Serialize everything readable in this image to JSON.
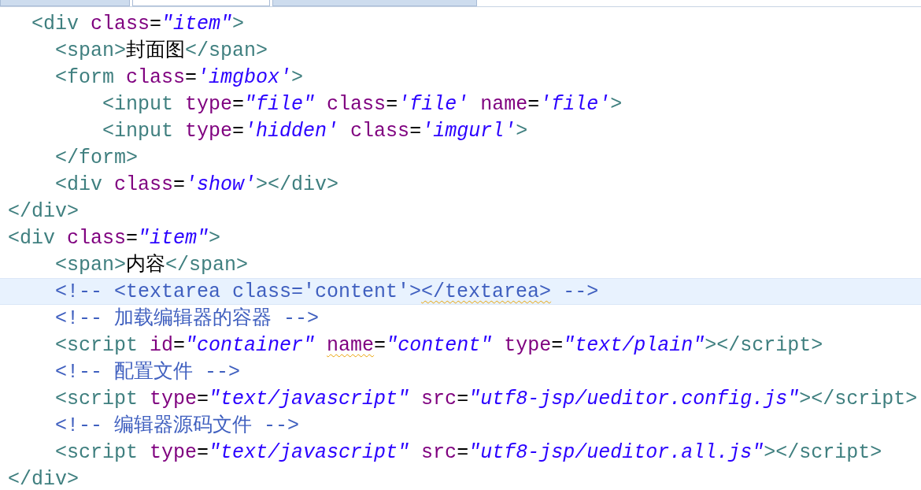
{
  "tabs": [
    {
      "selected": false
    },
    {
      "selected": true
    },
    {
      "selected": false
    }
  ],
  "lines": [
    {
      "current": false,
      "tokens": [
        {
          "kind": "tag",
          "text": "  <div "
        },
        {
          "kind": "attr",
          "text": "class"
        },
        {
          "kind": "plain",
          "text": "="
        },
        {
          "kind": "value",
          "text": "\"item\""
        },
        {
          "kind": "tag",
          "text": ">"
        }
      ]
    },
    {
      "current": false,
      "tokens": [
        {
          "kind": "tag",
          "text": "    <span>"
        },
        {
          "kind": "plain",
          "text": "封面图"
        },
        {
          "kind": "tag",
          "text": "</span>"
        }
      ]
    },
    {
      "current": false,
      "tokens": [
        {
          "kind": "tag",
          "text": "    <form "
        },
        {
          "kind": "attr",
          "text": "class"
        },
        {
          "kind": "plain",
          "text": "="
        },
        {
          "kind": "value",
          "text": "'imgbox'"
        },
        {
          "kind": "tag",
          "text": ">"
        }
      ]
    },
    {
      "current": false,
      "tokens": [
        {
          "kind": "tag",
          "text": "        <input "
        },
        {
          "kind": "attr",
          "text": "type"
        },
        {
          "kind": "plain",
          "text": "="
        },
        {
          "kind": "value",
          "text": "\"file\" "
        },
        {
          "kind": "attr",
          "text": "class"
        },
        {
          "kind": "plain",
          "text": "="
        },
        {
          "kind": "value",
          "text": "'file' "
        },
        {
          "kind": "attr",
          "text": "name"
        },
        {
          "kind": "plain",
          "text": "="
        },
        {
          "kind": "value",
          "text": "'file'"
        },
        {
          "kind": "tag",
          "text": ">"
        }
      ]
    },
    {
      "current": false,
      "tokens": [
        {
          "kind": "tag",
          "text": "        <input "
        },
        {
          "kind": "attr",
          "text": "type"
        },
        {
          "kind": "plain",
          "text": "="
        },
        {
          "kind": "value",
          "text": "'hidden' "
        },
        {
          "kind": "attr",
          "text": "class"
        },
        {
          "kind": "plain",
          "text": "="
        },
        {
          "kind": "value",
          "text": "'imgurl'"
        },
        {
          "kind": "tag",
          "text": ">"
        }
      ]
    },
    {
      "current": false,
      "tokens": [
        {
          "kind": "tag",
          "text": "    </form>"
        }
      ]
    },
    {
      "current": false,
      "tokens": [
        {
          "kind": "tag",
          "text": "    <div "
        },
        {
          "kind": "attr",
          "text": "class"
        },
        {
          "kind": "plain",
          "text": "="
        },
        {
          "kind": "value",
          "text": "'show'"
        },
        {
          "kind": "tag",
          "text": "></div>"
        }
      ]
    },
    {
      "current": false,
      "tokens": [
        {
          "kind": "tag",
          "text": "</div>"
        }
      ]
    },
    {
      "current": false,
      "tokens": [
        {
          "kind": "tag",
          "text": "<div "
        },
        {
          "kind": "attr",
          "text": "class"
        },
        {
          "kind": "plain",
          "text": "="
        },
        {
          "kind": "value",
          "text": "\"item\""
        },
        {
          "kind": "tag",
          "text": ">"
        }
      ]
    },
    {
      "current": false,
      "tokens": [
        {
          "kind": "tag",
          "text": "    <span>"
        },
        {
          "kind": "plain",
          "text": "内容"
        },
        {
          "kind": "tag",
          "text": "</span>"
        }
      ]
    },
    {
      "current": true,
      "tokens": [
        {
          "kind": "comment",
          "text": "    <!-- <textarea class='content'>",
          "warning": false
        },
        {
          "kind": "comment",
          "text": "</textarea>",
          "warning": true
        },
        {
          "kind": "comment",
          "text": " -->",
          "warning": false
        }
      ]
    },
    {
      "current": false,
      "tokens": [
        {
          "kind": "comment",
          "text": "    <!-- 加载编辑器的容器 -->"
        }
      ]
    },
    {
      "current": false,
      "tokens": [
        {
          "kind": "tag",
          "text": "    <script "
        },
        {
          "kind": "attr",
          "text": "id",
          "warning": false
        },
        {
          "kind": "plain",
          "text": "="
        },
        {
          "kind": "value",
          "text": "\"container\" "
        },
        {
          "kind": "attr",
          "text": "name",
          "warning": true
        },
        {
          "kind": "plain",
          "text": "="
        },
        {
          "kind": "value",
          "text": "\"content\" "
        },
        {
          "kind": "attr",
          "text": "type",
          "warning": false
        },
        {
          "kind": "plain",
          "text": "="
        },
        {
          "kind": "value",
          "text": "\"text/plain\""
        },
        {
          "kind": "tag",
          "text": "></script>"
        }
      ]
    },
    {
      "current": false,
      "tokens": [
        {
          "kind": "comment",
          "text": "    <!-- 配置文件 -->"
        }
      ]
    },
    {
      "current": false,
      "tokens": [
        {
          "kind": "tag",
          "text": "    <script "
        },
        {
          "kind": "attr",
          "text": "type"
        },
        {
          "kind": "plain",
          "text": "="
        },
        {
          "kind": "value",
          "text": "\"text/javascript\" "
        },
        {
          "kind": "attr",
          "text": "src"
        },
        {
          "kind": "plain",
          "text": "="
        },
        {
          "kind": "value",
          "text": "\"utf8-jsp/ueditor.config.js\""
        },
        {
          "kind": "tag",
          "text": "></script>"
        }
      ]
    },
    {
      "current": false,
      "tokens": [
        {
          "kind": "comment",
          "text": "    <!-- 编辑器源码文件 -->"
        }
      ]
    },
    {
      "current": false,
      "tokens": [
        {
          "kind": "tag",
          "text": "    <script "
        },
        {
          "kind": "attr",
          "text": "type"
        },
        {
          "kind": "plain",
          "text": "="
        },
        {
          "kind": "value",
          "text": "\"text/javascript\" "
        },
        {
          "kind": "attr",
          "text": "src"
        },
        {
          "kind": "plain",
          "text": "="
        },
        {
          "kind": "value",
          "text": "\"utf8-jsp/ueditor.all.js\""
        },
        {
          "kind": "tag",
          "text": "></script>"
        }
      ]
    },
    {
      "current": false,
      "tokens": [
        {
          "kind": "tag",
          "text": "</div>"
        }
      ]
    }
  ]
}
